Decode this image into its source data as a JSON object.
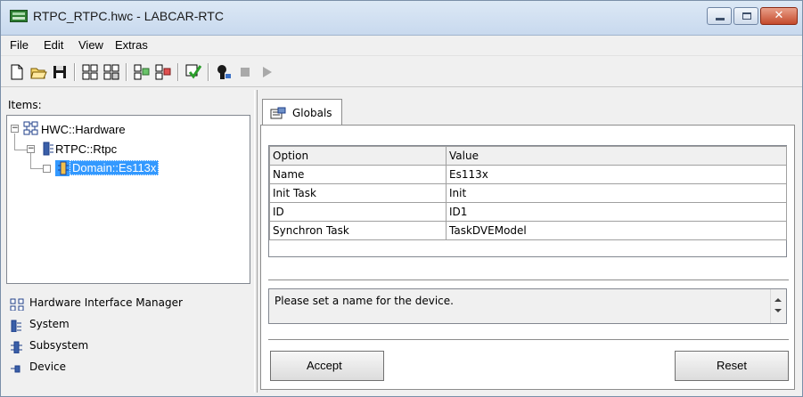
{
  "window": {
    "title": "RTPC_RTPC.hwc - LABCAR-RTC",
    "controls": {
      "minimize": "minimize",
      "maximize": "maximize",
      "close": "✕"
    }
  },
  "menu": [
    "File",
    "Edit",
    "View",
    "Extras"
  ],
  "toolbar": {
    "icons": [
      "new-icon",
      "open-icon",
      "save-icon",
      "add-item-icon",
      "remove-item-icon",
      "import-icon",
      "export-icon",
      "check-icon",
      "connect-icon",
      "stop-icon",
      "play-icon"
    ]
  },
  "left_pane": {
    "items_label": "Items:",
    "tree": [
      {
        "label": "HWC::Hardware",
        "level": 0,
        "expander": "−"
      },
      {
        "label": "RTPC::Rtpc",
        "level": 1,
        "expander": "−"
      },
      {
        "label": "Domain::Es113x",
        "level": 2,
        "expander": "",
        "selected": true
      }
    ],
    "legend": [
      {
        "icon": "hardware-interface-manager-icon",
        "label": "Hardware Interface Manager"
      },
      {
        "icon": "system-icon",
        "label": "System"
      },
      {
        "icon": "subsystem-icon",
        "label": "Subsystem"
      },
      {
        "icon": "device-icon",
        "label": "Device"
      }
    ]
  },
  "right_pane": {
    "tab_label": "Globals",
    "grid": {
      "columns": [
        "Option",
        "Value"
      ],
      "rows": [
        [
          "Name",
          "Es113x"
        ],
        [
          "Init Task",
          "Init"
        ],
        [
          "ID",
          "ID1"
        ],
        [
          "Synchron Task",
          "TaskDVEModel"
        ]
      ]
    },
    "message": "Please set a name for the device.",
    "accept_label": "Accept",
    "reset_label": "Reset"
  },
  "colors": {
    "selection": "#3399ff",
    "titlebar": "#c8d9ee",
    "close_button": "#c44a2c"
  }
}
